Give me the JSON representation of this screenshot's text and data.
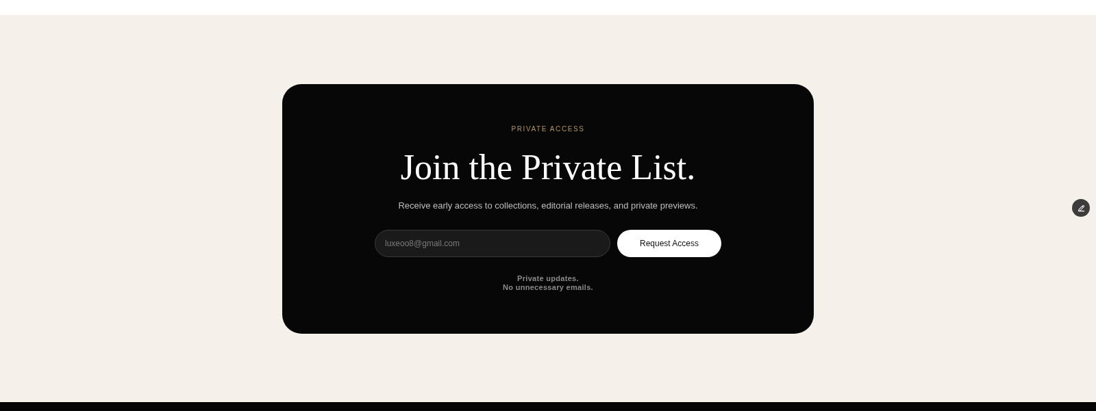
{
  "signup_card": {
    "eyebrow": "PRIVATE ACCESS",
    "title": "Join the Private List.",
    "subtitle": "Receive early access to collections, editorial releases, and private previews.",
    "email_field": {
      "placeholder": "luxeoo8@gmail.com"
    },
    "submit_button": {
      "label": "Request Access"
    },
    "note": "Private updates.\nNo unnecessary emails."
  }
}
